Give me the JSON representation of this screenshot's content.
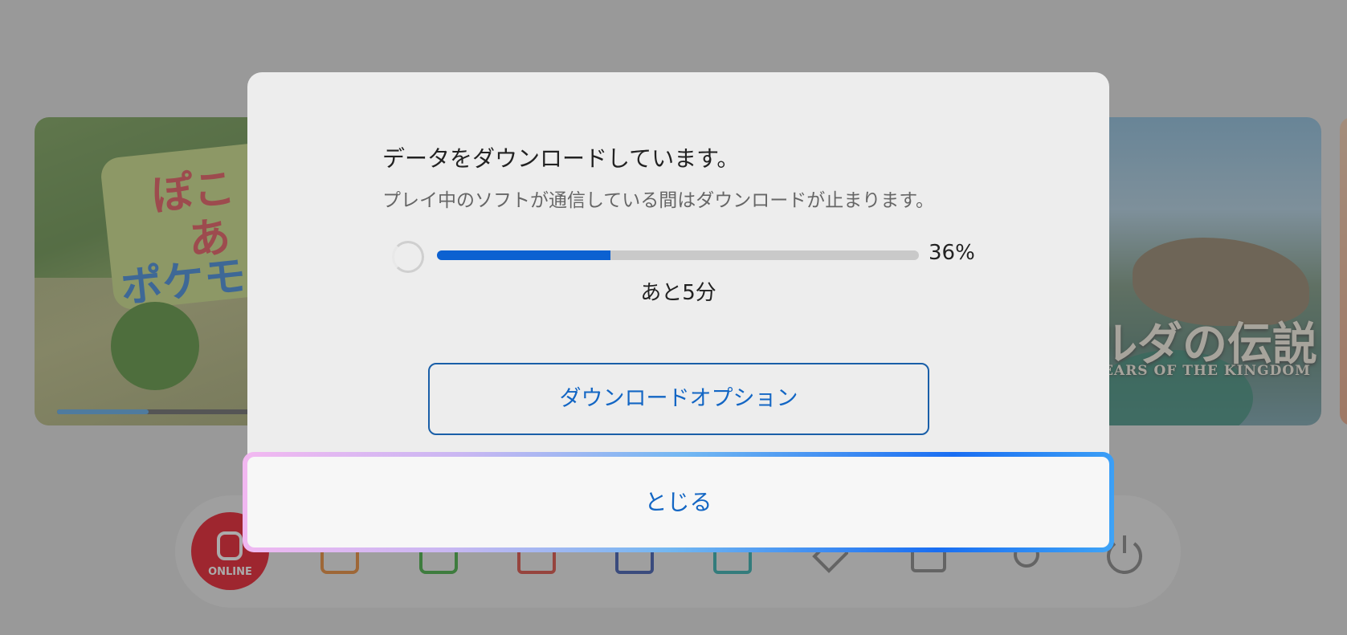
{
  "background": {
    "left_tile": {
      "title_lines": [
        "ぽこ",
        "あ",
        "ポケモ"
      ],
      "progress_fraction": 0.42
    },
    "right_tile": {
      "title_jp": "ルダの伝説",
      "title_en": "TEARS OF THE KINGDOM"
    },
    "dock": {
      "online_label": "ONLINE",
      "items": [
        "online-icon",
        "news-icon",
        "eshop-icon",
        "album-icon",
        "controllers-icon",
        "screen-icon",
        "tag-icon",
        "download-icon",
        "settings-icon",
        "power-icon"
      ]
    }
  },
  "dialog": {
    "title": "データをダウンロードしています。",
    "subtitle": "プレイ中のソフトが通信している間はダウンロードが止まります。",
    "progress_percent": 36,
    "progress_label": "36%",
    "remaining": "あと5分",
    "options_button": "ダウンロードオプション",
    "close_button": "とじる"
  },
  "colors": {
    "accent": "#1366c4",
    "progress": "#0c61d1",
    "online_red": "#e60012"
  }
}
